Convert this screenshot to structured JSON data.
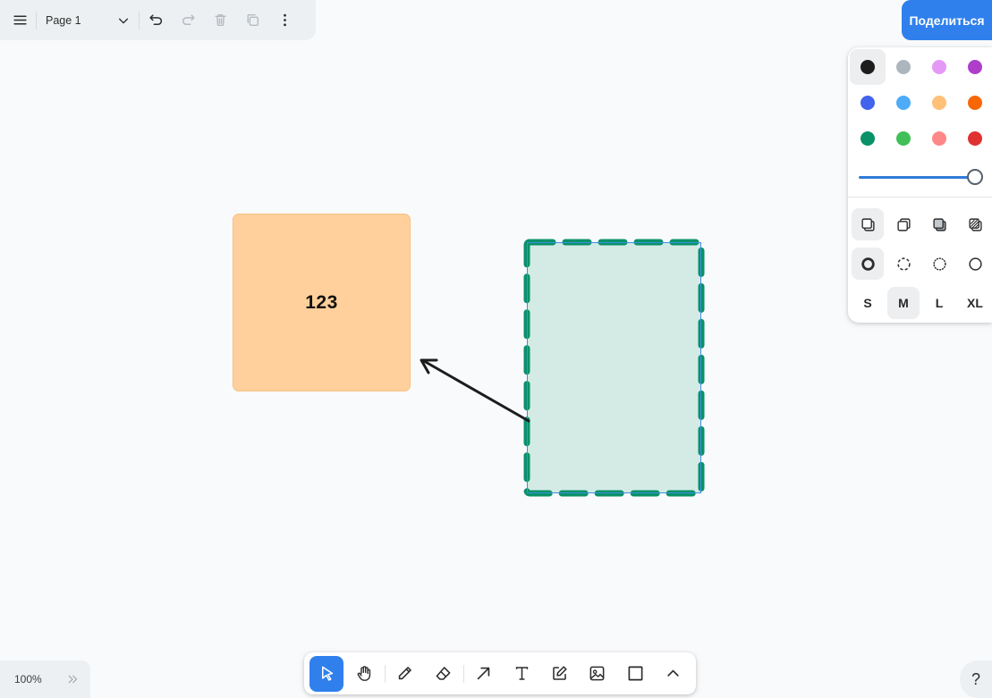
{
  "header": {
    "page_label": "Page 1",
    "share_label": "Поделиться"
  },
  "style_panel": {
    "colors": [
      {
        "name": "black",
        "hex": "#1d1d1d",
        "selected": true
      },
      {
        "name": "grey",
        "hex": "#adb5bd",
        "selected": false
      },
      {
        "name": "light-violet",
        "hex": "#e599f7",
        "selected": false
      },
      {
        "name": "violet",
        "hex": "#ae3ec9",
        "selected": false
      },
      {
        "name": "blue",
        "hex": "#4263eb",
        "selected": false
      },
      {
        "name": "light-blue",
        "hex": "#4dabf7",
        "selected": false
      },
      {
        "name": "yellow",
        "hex": "#ffc078",
        "selected": false
      },
      {
        "name": "orange",
        "hex": "#f76707",
        "selected": false
      },
      {
        "name": "green",
        "hex": "#099268",
        "selected": false
      },
      {
        "name": "light-green",
        "hex": "#40c057",
        "selected": false
      },
      {
        "name": "light-red",
        "hex": "#ff8787",
        "selected": false
      },
      {
        "name": "red",
        "hex": "#e03131",
        "selected": false
      }
    ],
    "opacity": 1.0,
    "fill_options": [
      "fill-none",
      "fill-semi",
      "fill-solid",
      "fill-pattern"
    ],
    "dash_options": [
      "dash-draw",
      "dash-dashed",
      "dash-dotted",
      "dash-solid"
    ],
    "sizes": [
      "S",
      "M",
      "L",
      "XL"
    ],
    "selected_size": "M"
  },
  "canvas": {
    "orange_shape_text": "123",
    "orange_fill": "#ffd09b",
    "green_fill": "#d3ebe4",
    "green_stroke": "#099268"
  },
  "toolbar": {
    "tools": [
      "select",
      "hand",
      "draw",
      "eraser",
      "arrow",
      "text",
      "note",
      "asset",
      "rectangle",
      "more"
    ],
    "active_tool": "select"
  },
  "footer": {
    "zoom": "100%",
    "help": "?"
  }
}
